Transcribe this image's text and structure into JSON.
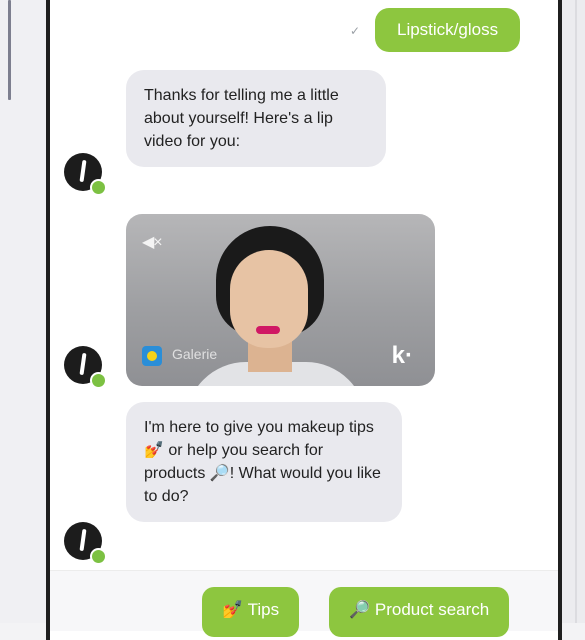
{
  "user_message": "Lipstick/gloss",
  "read_icon": "read-receipt-icon",
  "bot_messages": [
    "Thanks for telling me a little about yourself! Here's a lip video for you:",
    "I'm here to give you makeup tips 💅 or help you search for products 🔎! What would you like to do?"
  ],
  "video": {
    "channel": "Galerie",
    "brand": "k·",
    "mute_icon": "speaker-muted-icon"
  },
  "quick_replies": {
    "tips": "💅 Tips",
    "product_search": "🔎 Product search"
  },
  "colors": {
    "accent_green": "#8dc63f",
    "bot_bubble": "#e9e9ee",
    "lip_color": "#d01864"
  }
}
